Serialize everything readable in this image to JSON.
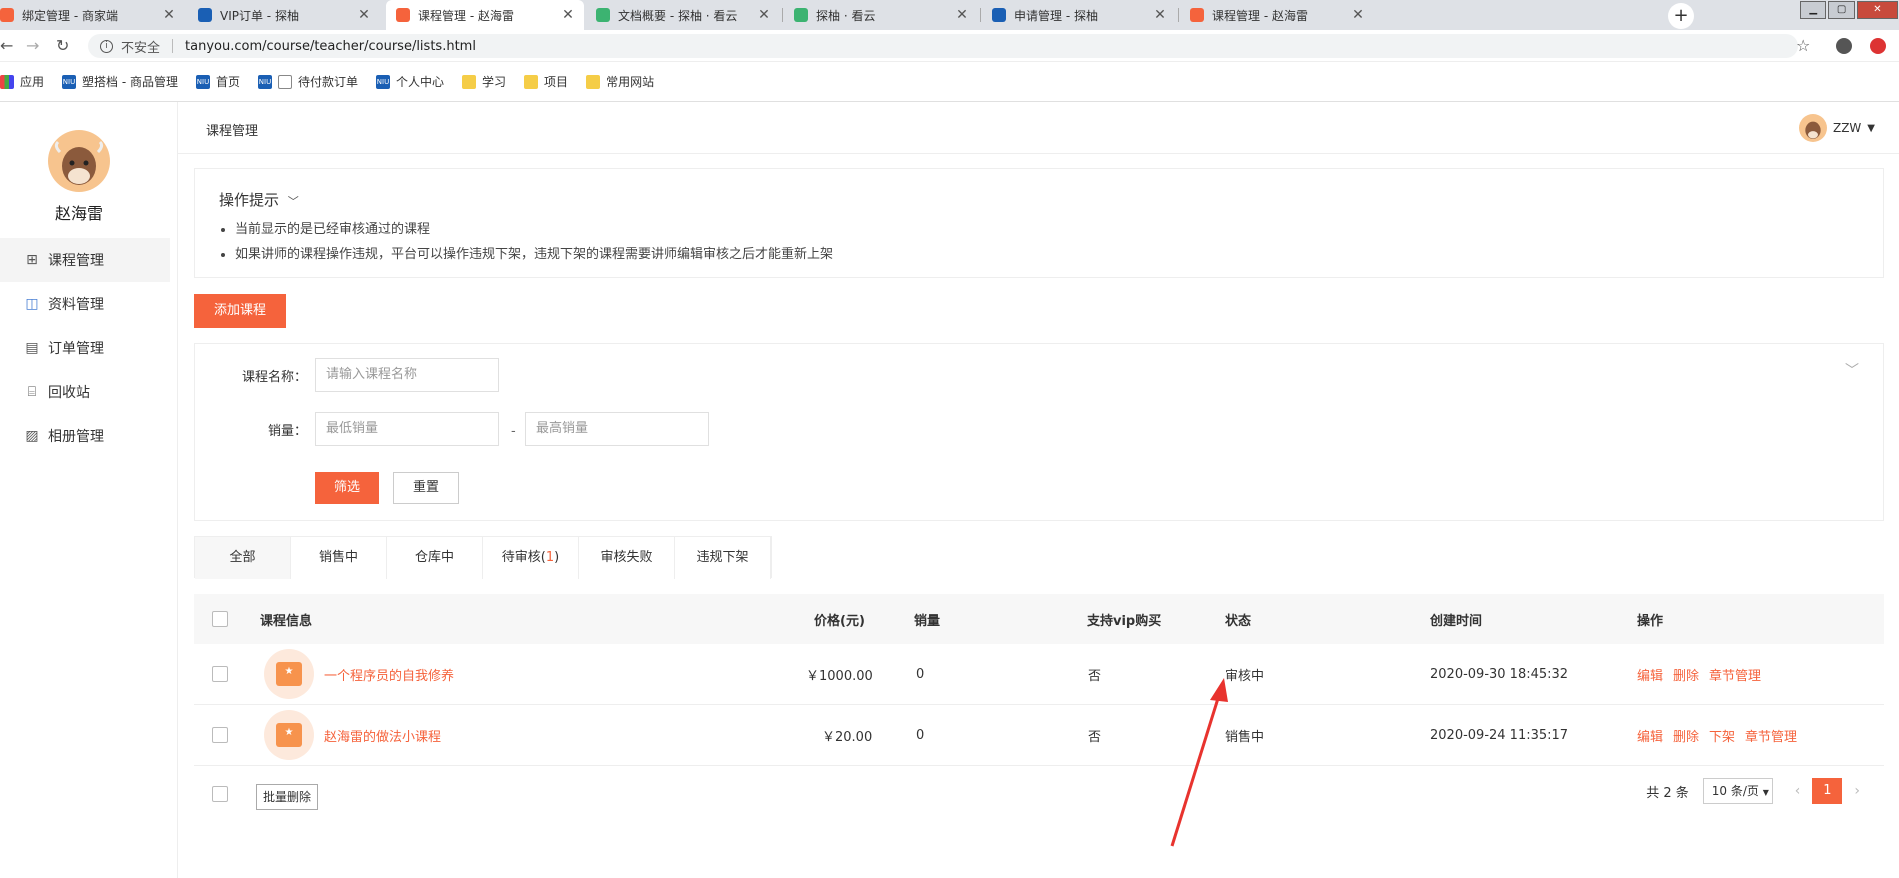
{
  "browser": {
    "tabs": [
      {
        "label": "绑定管理 - 商家端",
        "color": "#f5633c"
      },
      {
        "label": "VIP订单 - 探柚",
        "color": "#1a5fb4"
      },
      {
        "label": "课程管理 - 赵海雷",
        "color": "#f5633c"
      },
      {
        "label": "文档概要 - 探柚 · 看云",
        "color": "#3cb371"
      },
      {
        "label": "探柚 · 看云",
        "color": "#3cb371"
      },
      {
        "label": "申请管理 - 探柚",
        "color": "#1a5fb4"
      },
      {
        "label": "课程管理 - 赵海雷",
        "color": "#f5633c"
      }
    ],
    "new_tab": "+",
    "insecure_label": "不安全",
    "url": "tanyou.com/course/teacher/course/lists.html",
    "bookmarks": [
      "应用",
      "塑搭档 - 商品管理",
      "首页",
      "待付款订单",
      "个人中心",
      "学习",
      "项目",
      "常用网站"
    ]
  },
  "sidebar": {
    "username": "赵海雷",
    "items": [
      {
        "label": "课程管理",
        "icon": "gift-icon"
      },
      {
        "label": "资料管理",
        "icon": "bag-icon"
      },
      {
        "label": "订单管理",
        "icon": "document-icon"
      },
      {
        "label": "回收站",
        "icon": "trash-icon"
      },
      {
        "label": "相册管理",
        "icon": "image-icon"
      }
    ]
  },
  "header": {
    "title": "课程管理",
    "user": "ZZW"
  },
  "tips": {
    "title": "操作提示",
    "items": [
      "当前显示的是已经审核通过的课程",
      "如果讲师的课程操作违规，平台可以操作违规下架，违规下架的课程需要讲师编辑审核之后才能重新上架"
    ]
  },
  "add_button": "添加课程",
  "filter": {
    "name_label": "课程名称：",
    "name_placeholder": "请输入课程名称",
    "sales_label": "销量：",
    "min_placeholder": "最低销量",
    "max_placeholder": "最高销量",
    "dash": "-",
    "submit": "筛选",
    "reset": "重置"
  },
  "tabs": {
    "all": "全部",
    "selling": "销售中",
    "warehouse": "仓库中",
    "pending": "待审核(",
    "pending_count": "1",
    "pending_close": ")",
    "failed": "审核失败",
    "removed": "违规下架"
  },
  "table": {
    "columns": [
      "课程信息",
      "价格(元)",
      "销量",
      "支持vip购买",
      "状态",
      "创建时间",
      "操作"
    ],
    "rows": [
      {
        "title": "一个程序员的自我修养",
        "price": "￥1000.00",
        "sales": "0",
        "vip": "否",
        "status": "审核中",
        "created": "2020-09-30 18:45:32",
        "ops": [
          "编辑",
          "删除",
          "章节管理"
        ]
      },
      {
        "title": "赵海雷的做法小课程",
        "price": "￥20.00",
        "sales": "0",
        "vip": "否",
        "status": "销售中",
        "created": "2020-09-24 11:35:17",
        "ops": [
          "编辑",
          "删除",
          "下架",
          "章节管理"
        ]
      }
    ],
    "batch_delete": "批量删除",
    "total": "共 2 条",
    "page_size": "10 条/页",
    "current_page": "1"
  },
  "colors": {
    "accent": "#f5633c"
  }
}
